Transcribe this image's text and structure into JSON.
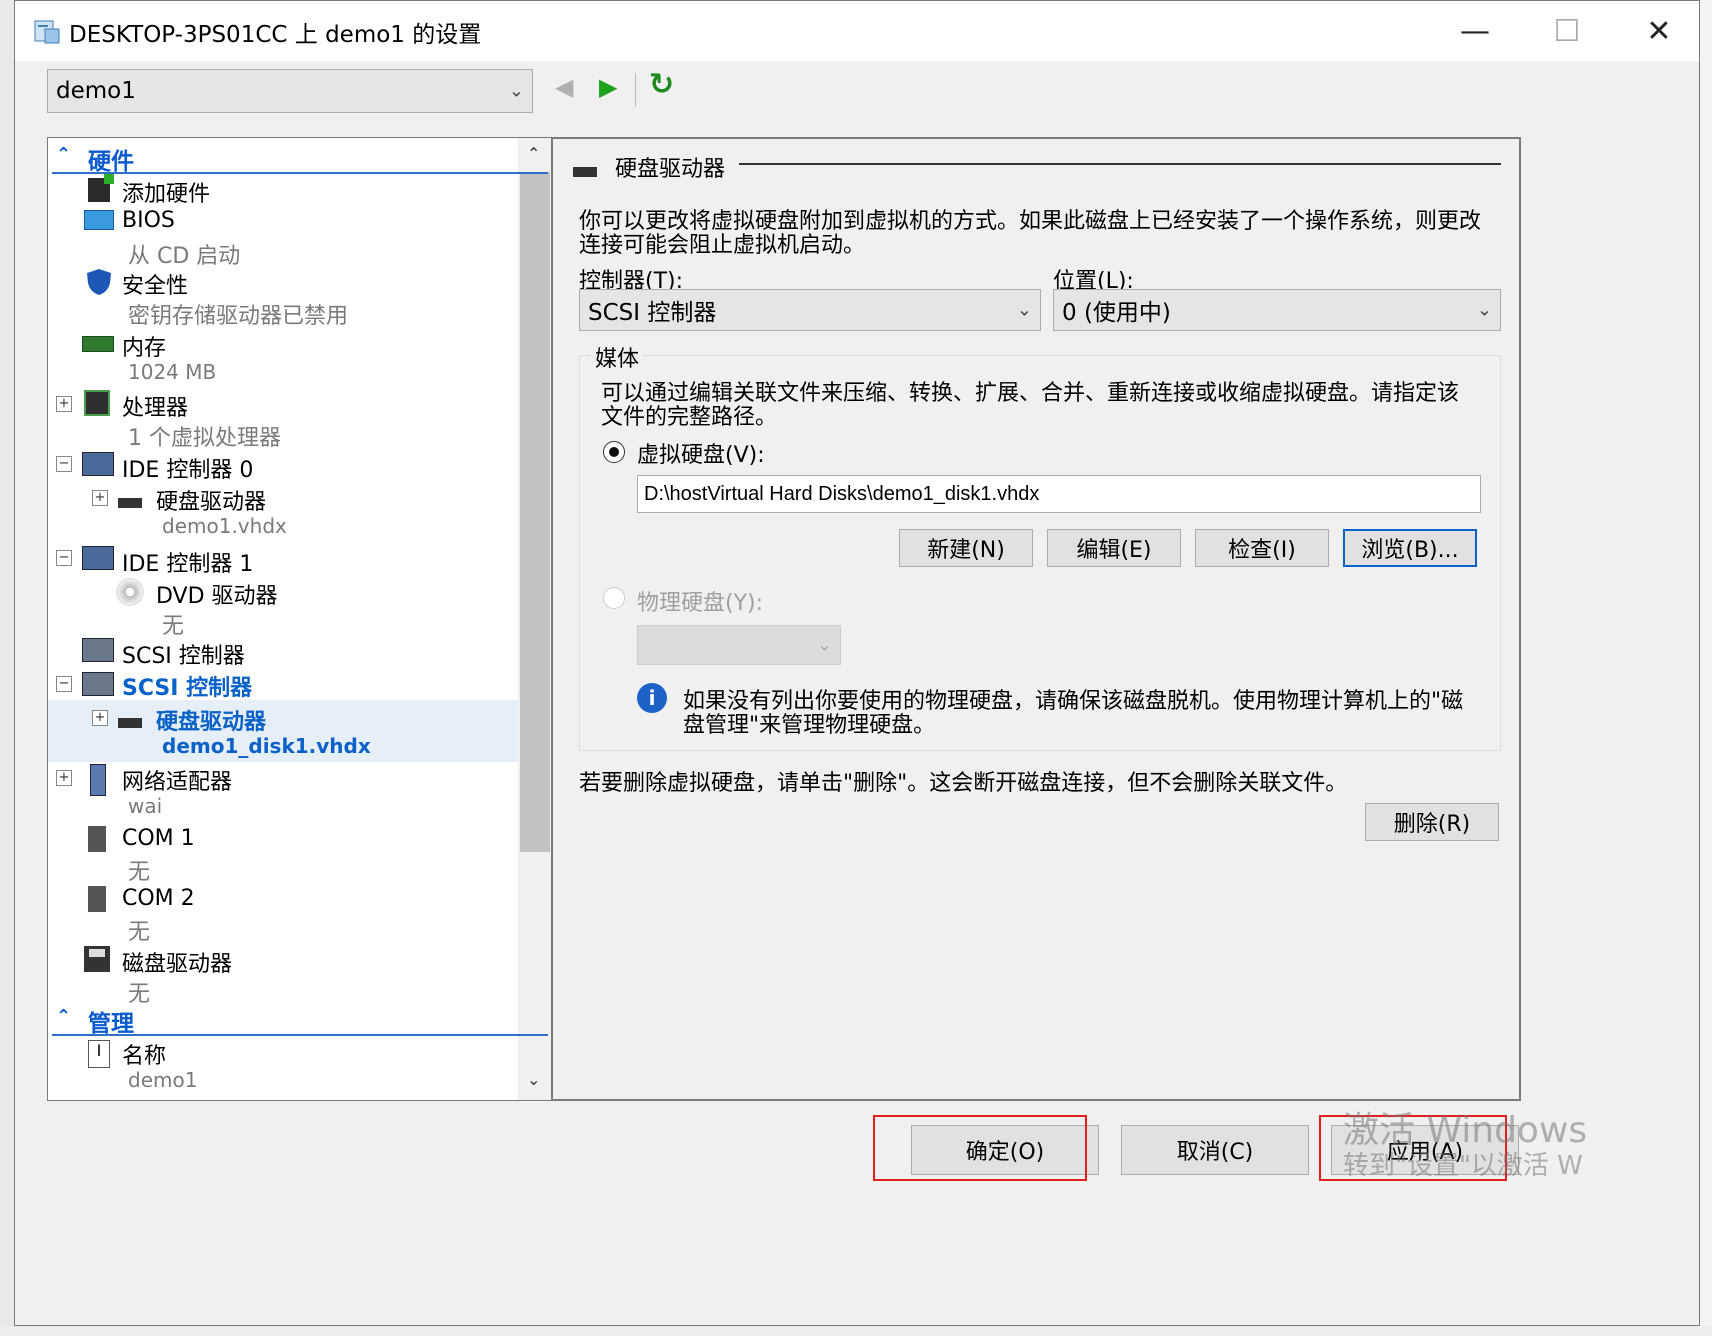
{
  "window": {
    "title": "DESKTOP-3PS01CC 上 demo1 的设置",
    "minimize": "—",
    "maximize": "☐",
    "close": "✕"
  },
  "vm_selector": {
    "value": "demo1"
  },
  "toolbar": {
    "back": "◀",
    "forward": "▶",
    "refresh": "↻"
  },
  "tree": {
    "hardware_header": "硬件",
    "items": {
      "add_hw": "添加硬件",
      "bios": "BIOS",
      "bios_sub": "从 CD 启动",
      "security": "安全性",
      "security_sub": "密钥存储驱动器已禁用",
      "memory": "内存",
      "memory_sub": "1024 MB",
      "processor": "处理器",
      "processor_sub": "1 个虚拟处理器",
      "ide0": "IDE 控制器 0",
      "ide0_disk": "硬盘驱动器",
      "ide0_disk_sub": "demo1.vhdx",
      "ide1": "IDE 控制器 1",
      "dvd": "DVD 驱动器",
      "dvd_sub": "无",
      "scsi1": "SCSI 控制器",
      "scsi2": "SCSI 控制器",
      "scsi_disk": "硬盘驱动器",
      "scsi_disk_sub": "demo1_disk1.vhdx",
      "nic": "网络适配器",
      "nic_sub": "wai",
      "com1": "COM 1",
      "com1_sub": "无",
      "com2": "COM 2",
      "com2_sub": "无",
      "floppy": "磁盘驱动器",
      "floppy_sub": "无"
    },
    "mgmt_header": "管理",
    "name_label": "名称",
    "name_sub": "demo1"
  },
  "detail": {
    "heading": "硬盘驱动器",
    "intro_line1": "你可以更改将虚拟硬盘附加到虚拟机的方式。如果此磁盘上已经安装了一个操作系统，则更改",
    "intro_line2": "连接可能会阻止虚拟机启动。",
    "controller_label": "控制器(T):",
    "controller_value": "SCSI 控制器",
    "location_label": "位置(L):",
    "location_value": "0 (使用中)",
    "media_label": "媒体",
    "media_desc1": "可以通过编辑关联文件来压缩、转换、扩展、合并、重新连接或收缩虚拟硬盘。请指定该",
    "media_desc2": "文件的完整路径。",
    "vhd_radio": "虚拟硬盘(V):",
    "vhd_path": "D:\\hostVirtual Hard Disks\\demo1_disk1.vhdx",
    "btn_new": "新建(N)",
    "btn_edit": "编辑(E)",
    "btn_inspect": "检查(I)",
    "btn_browse": "浏览(B)...",
    "phys_radio": "物理硬盘(Y):",
    "info_line1": "如果没有列出你要使用的物理硬盘，请确保该磁盘脱机。使用物理计算机上的\"磁",
    "info_line2": "盘管理\"来管理物理硬盘。",
    "remove_text": "若要删除虚拟硬盘，请单击\"删除\"。这会断开磁盘连接，但不会删除关联文件。",
    "btn_remove": "删除(R)"
  },
  "footer": {
    "ok": "确定(O)",
    "cancel": "取消(C)",
    "apply": "应用(A)"
  },
  "watermark": {
    "line1": "激活 Windows",
    "line2": "转到\"设置\"以激活 W"
  },
  "colors": {
    "accent": "#0a62c9",
    "highlight_box": "#e02020"
  }
}
